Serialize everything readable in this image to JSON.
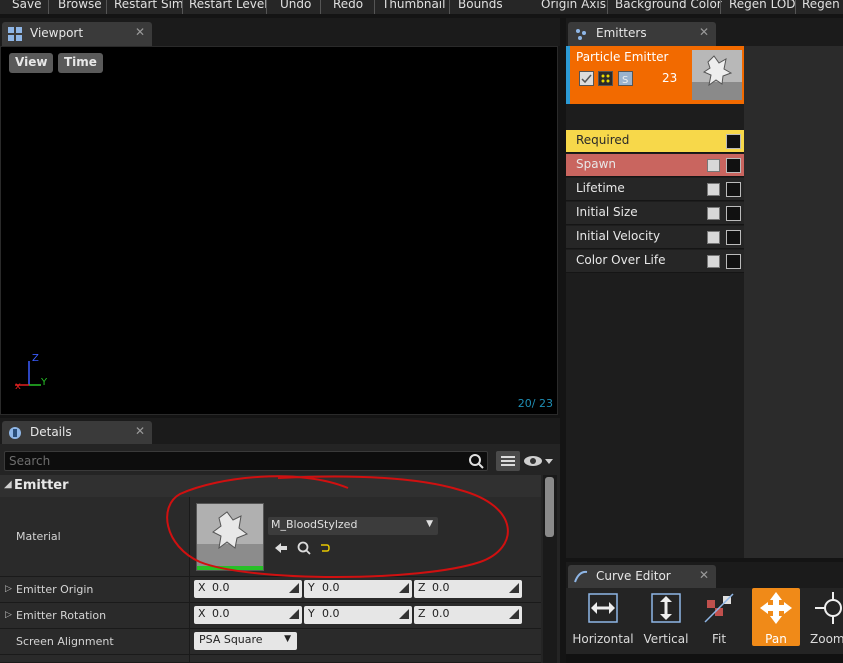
{
  "toolbar": {
    "items": [
      "Save",
      "Browse",
      "Restart Sim",
      "Restart Level",
      "Undo",
      "Redo",
      "Thumbnail",
      "Bounds",
      "Origin Axis",
      "Background Color",
      "Regen LOD",
      "Regen L"
    ]
  },
  "viewport": {
    "tab_label": "Viewport",
    "view_button": "View",
    "time_button": "Time",
    "particle_counter": "20/ 23",
    "axis_z": "Z",
    "axis_y": "Y"
  },
  "details": {
    "tab_label": "Details",
    "search_placeholder": "Search",
    "category": "Emitter",
    "material_label": "Material",
    "material_value": "M_BloodStylzed",
    "emitter_origin_label": "Emitter Origin",
    "emitter_rotation_label": "Emitter Rotation",
    "screen_alignment_label": "Screen Alignment",
    "screen_alignment_value": "PSA Square",
    "origin": {
      "x_axis": "X",
      "x": "0.0",
      "y_axis": "Y",
      "y": "0.0",
      "z_axis": "Z",
      "z": "0.0"
    },
    "rotation": {
      "x_axis": "X",
      "x": "0.0",
      "y_axis": "Y",
      "y": "0.0",
      "z_axis": "Z",
      "z": "0.0"
    },
    "annotation_color": "#d01010"
  },
  "emitters": {
    "tab_label": "Emitters",
    "emitter_name": "Particle Emitter",
    "particle_count": "23",
    "header_color": "#f26a00",
    "modules": [
      {
        "label": "Required",
        "color": "#f7d84a"
      },
      {
        "label": "Spawn",
        "color": "#c9655f"
      },
      {
        "label": "Lifetime"
      },
      {
        "label": "Initial Size"
      },
      {
        "label": "Initial Velocity"
      },
      {
        "label": "Color Over Life"
      }
    ]
  },
  "curve_editor": {
    "tab_label": "Curve Editor",
    "buttons": [
      "Horizontal",
      "Vertical",
      "Fit",
      "Pan",
      "Zoom"
    ],
    "active_color": "#f08a18"
  }
}
